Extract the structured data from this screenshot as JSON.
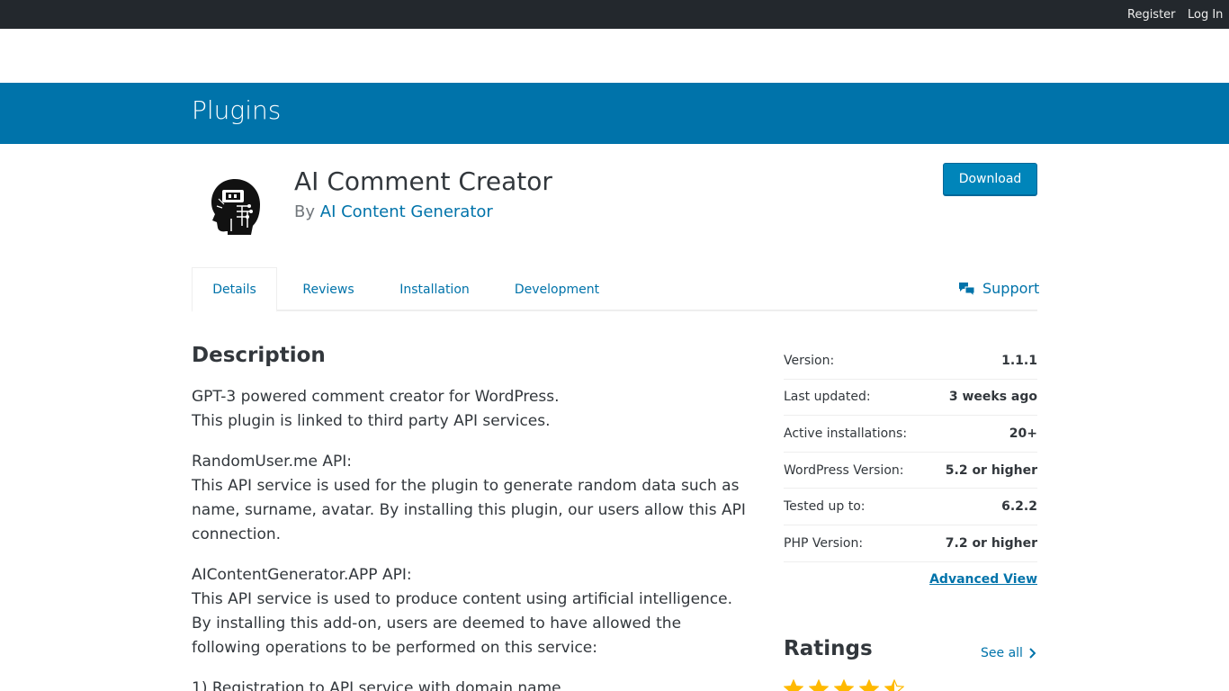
{
  "topbar": {
    "register": "Register",
    "login": "Log In"
  },
  "banner": {
    "title": "Plugins"
  },
  "plugin": {
    "title": "AI Comment Creator",
    "by_prefix": "By",
    "author": "AI Content Generator",
    "download_label": "Download"
  },
  "tabs": [
    {
      "label": "Details"
    },
    {
      "label": "Reviews"
    },
    {
      "label": "Installation"
    },
    {
      "label": "Development"
    }
  ],
  "support_label": "Support",
  "description": {
    "heading": "Description",
    "p1_line1": "GPT-3 powered comment creator for WordPress.",
    "p1_line2": "This plugin is linked to third party API services.",
    "p2_line1": "RandomUser.me API:",
    "p2_body": "This API service is used for the plugin to generate random data such as name, surname, avatar. By installing this plugin, our users allow this API connection.",
    "p3_line1": "AIContentGenerator.APP API:",
    "p3_body": "This API service is used to produce content using artificial intelligence. By installing this add-on, users are deemed to have allowed the following operations to be performed on this service:",
    "p4_partial": "1) Registration to API service with domain name"
  },
  "meta": [
    {
      "label": "Version:",
      "value": "1.1.1"
    },
    {
      "label": "Last updated:",
      "value": "3 weeks ago"
    },
    {
      "label": "Active installations:",
      "value": "20+"
    },
    {
      "label": "WordPress Version:",
      "value": "5.2 or higher"
    },
    {
      "label": "Tested up to:",
      "value": "6.2.2"
    },
    {
      "label": "PHP Version:",
      "value": "7.2 or higher"
    }
  ],
  "advanced_view": "Advanced View",
  "ratings": {
    "title": "Ratings",
    "see_all": "See all",
    "stars": 4.5
  },
  "colors": {
    "brand_blue": "#0073aa",
    "topbar": "#23282d",
    "star": "#ffb900"
  }
}
